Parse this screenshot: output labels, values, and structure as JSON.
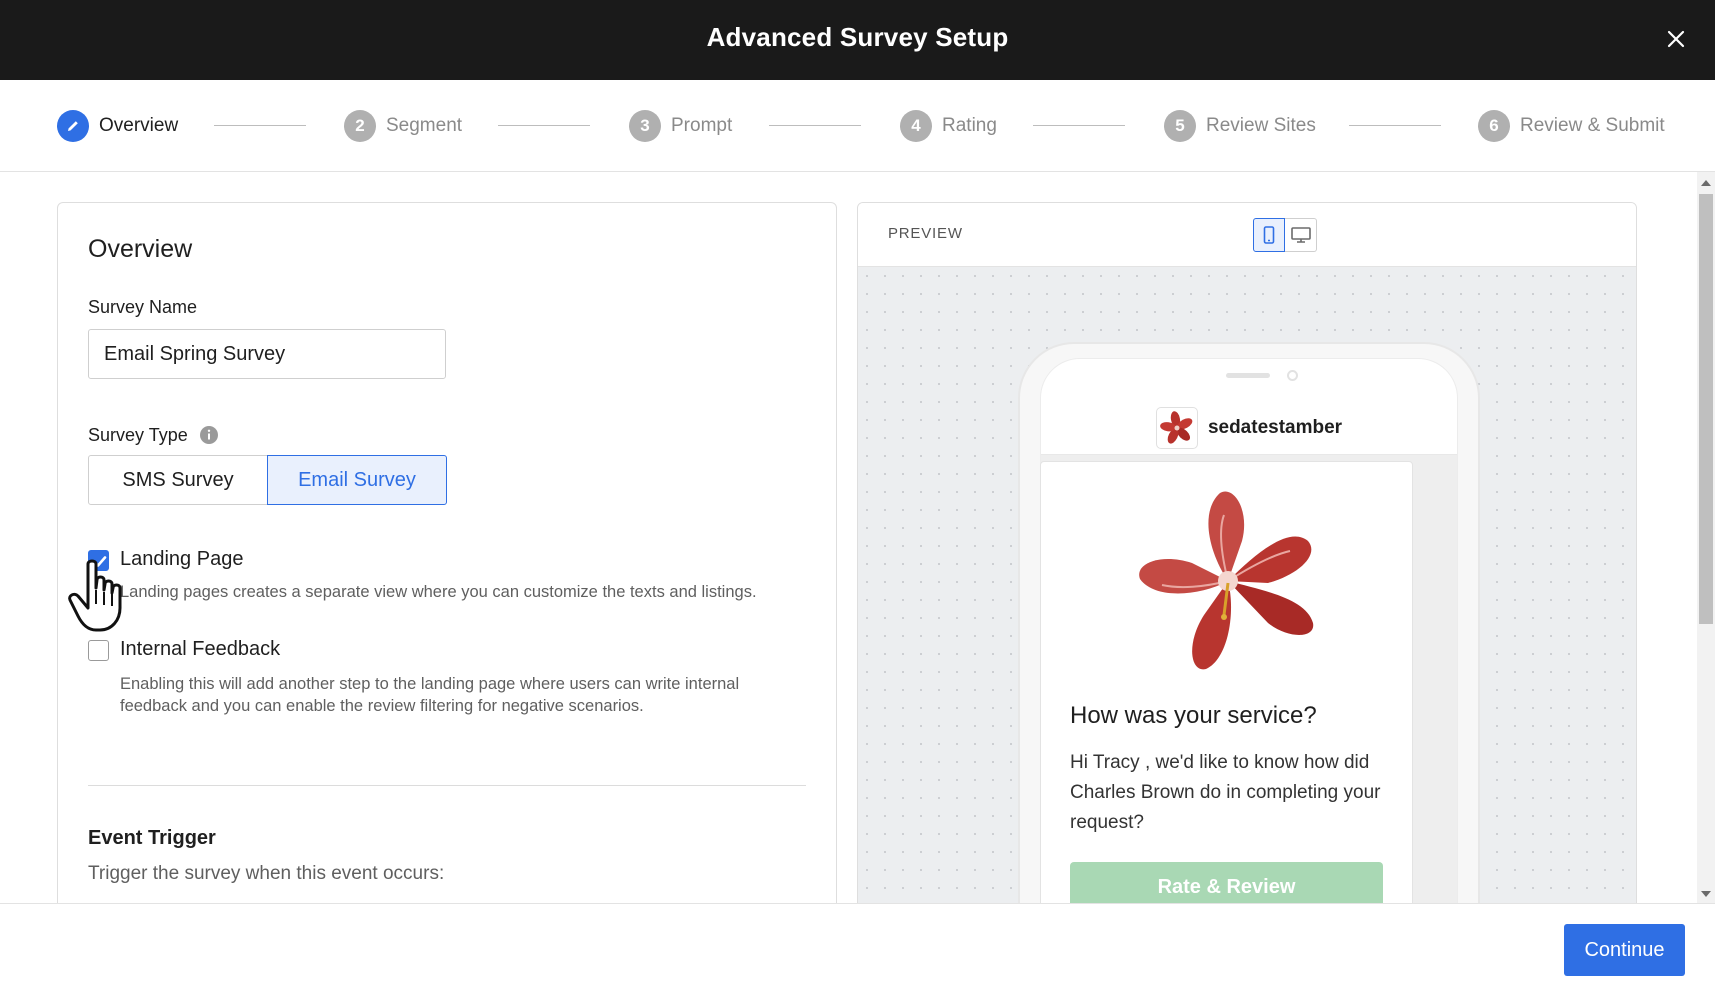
{
  "window": {
    "title": "Advanced Survey Setup"
  },
  "stepper": {
    "steps": [
      {
        "number": "1",
        "label": "Overview",
        "active": true
      },
      {
        "number": "2",
        "label": "Segment"
      },
      {
        "number": "3",
        "label": "Prompt"
      },
      {
        "number": "4",
        "label": "Rating"
      },
      {
        "number": "5",
        "label": "Review Sites"
      },
      {
        "number": "6",
        "label": "Review & Submit"
      }
    ]
  },
  "overview": {
    "heading": "Overview",
    "survey_name_label": "Survey Name",
    "survey_name_value": "Email Spring Survey",
    "survey_type_label": "Survey Type",
    "survey_type_options": [
      "SMS Survey",
      "Email Survey"
    ],
    "survey_type_selected": "Email Survey",
    "landing_page": {
      "label": "Landing Page",
      "checked": true,
      "description": "Landing pages creates a separate view where you can customize the texts and listings."
    },
    "internal_feedback": {
      "label": "Internal Feedback",
      "checked": false,
      "description_line1": "Enabling this will add another step to the landing page where users can write internal",
      "description_line2": "feedback and you can enable the review filtering for negative scenarios."
    },
    "event_trigger_heading": "Event Trigger",
    "event_trigger_description": "Trigger the survey when this event occurs:"
  },
  "preview": {
    "title": "PREVIEW",
    "device_selected": "mobile",
    "brand_name": "sedatestamber",
    "question_title": "How was your service?",
    "question_body": "Hi Tracy , we'd like to know how did Charles Brown do in completing your request?",
    "rate_button": "Rate & Review"
  },
  "footer": {
    "continue_label": "Continue"
  },
  "colors": {
    "accent": "#2f6fe4",
    "titlebar": "#1a1a1a",
    "rate_button": "#a9d8b4"
  }
}
